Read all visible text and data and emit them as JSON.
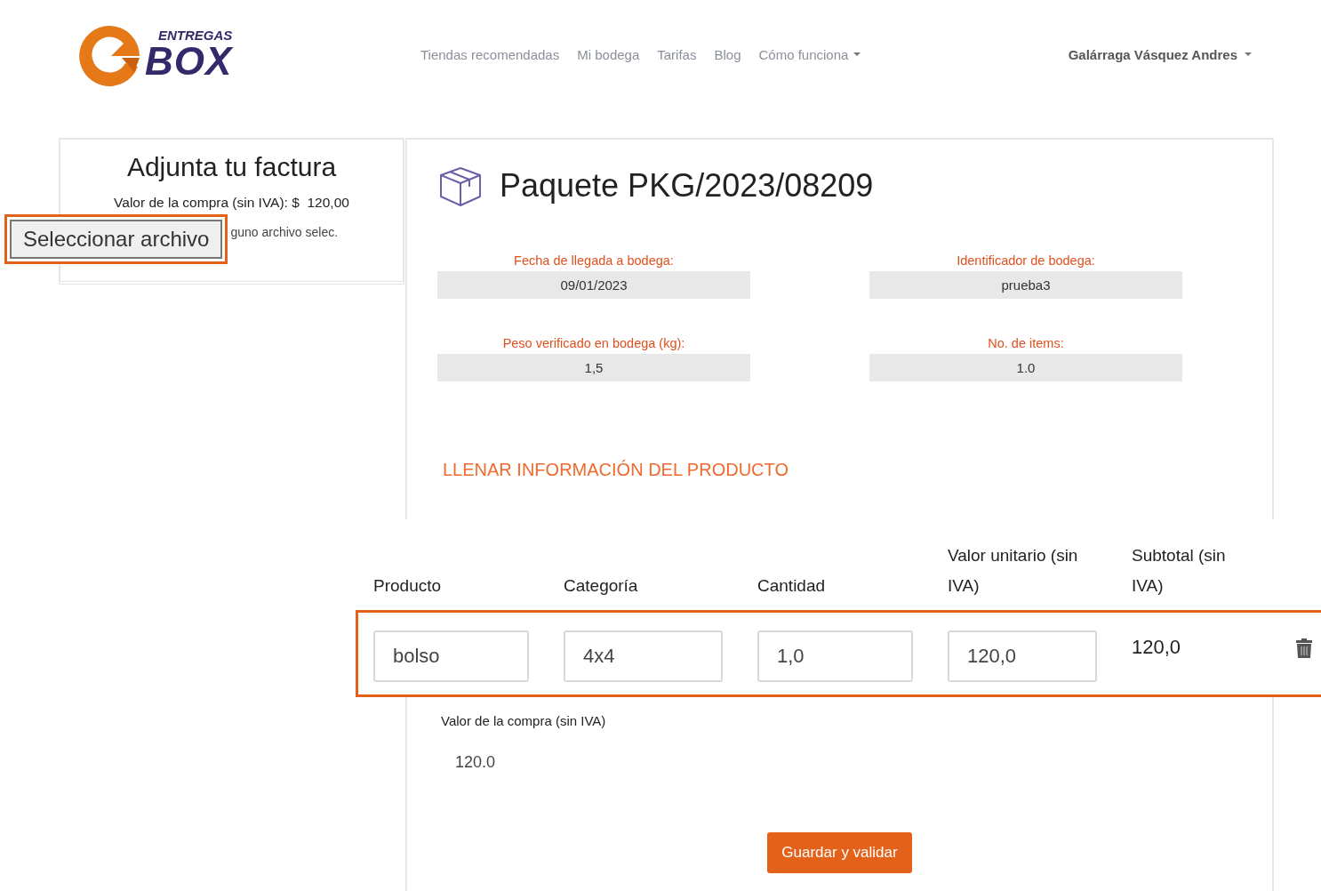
{
  "header": {
    "logo": {
      "top": "ENTREGAS",
      "bottom": "BOX"
    },
    "nav": [
      {
        "label": "Tiendas recomendadas",
        "dropdown": false
      },
      {
        "label": "Mi bodega",
        "dropdown": false
      },
      {
        "label": "Tarifas",
        "dropdown": false
      },
      {
        "label": "Blog",
        "dropdown": false
      },
      {
        "label": "Cómo funciona",
        "dropdown": true
      }
    ],
    "user": {
      "name": "Galárraga Vásquez Andres",
      "dropdown": true
    }
  },
  "invoice": {
    "title": "Adjunta tu factura",
    "amount_label": "Valor de la compra (sin IVA): $",
    "amount": "120,00",
    "file_button": "Seleccionar archivo",
    "file_status": "guno archivo selec."
  },
  "package": {
    "title": "Paquete PKG/2023/08209",
    "fields": [
      {
        "label": "Fecha de llegada a bodega:",
        "value": "09/01/2023"
      },
      {
        "label": "Identificador de bodega:",
        "value": "prueba3"
      },
      {
        "label": "Peso verificado en bodega (kg):",
        "value": "1,5"
      },
      {
        "label": "No. de items:",
        "value": "1.0"
      }
    ],
    "section_title": "LLENAR INFORMACIÓN DEL PRODUCTO",
    "table": {
      "columns": [
        "Producto",
        "Categoría",
        "Cantidad",
        "Valor unitario (sin IVA)",
        "Subtotal (sin IVA)"
      ],
      "rows": [
        {
          "product": "bolso",
          "category": "4x4",
          "quantity": "1,0",
          "unit_value": "120,0",
          "subtotal": "120,0"
        }
      ]
    },
    "total_label": "Valor de la compra (sin IVA)",
    "total": "120.0",
    "submit": "Guardar y validar"
  }
}
